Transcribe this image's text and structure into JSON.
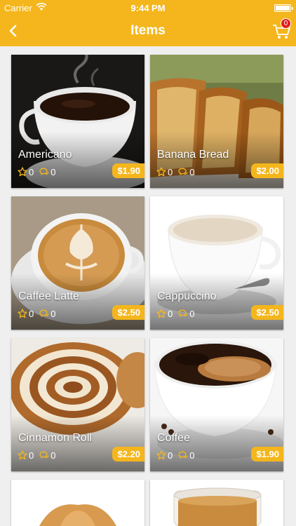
{
  "status_bar": {
    "carrier": "Carrier",
    "time": "9:44 PM"
  },
  "nav": {
    "title": "Items",
    "cart_count": "0"
  },
  "colors": {
    "accent": "#f4b61c",
    "badge": "#e21e1e",
    "background": "#efefef"
  },
  "items": [
    {
      "name": "Americano",
      "rating": "0",
      "comments": "0",
      "price": "$1.90"
    },
    {
      "name": "Banana Bread",
      "rating": "0",
      "comments": "0",
      "price": "$2.00"
    },
    {
      "name": "Caffee Latte",
      "rating": "0",
      "comments": "0",
      "price": "$2.50"
    },
    {
      "name": "Cappuccino",
      "rating": "0",
      "comments": "0",
      "price": "$2.50"
    },
    {
      "name": "Cinnamon Roll",
      "rating": "0",
      "comments": "0",
      "price": "$2.20"
    },
    {
      "name": "Coffee",
      "rating": "0",
      "comments": "0",
      "price": "$1.90"
    }
  ]
}
